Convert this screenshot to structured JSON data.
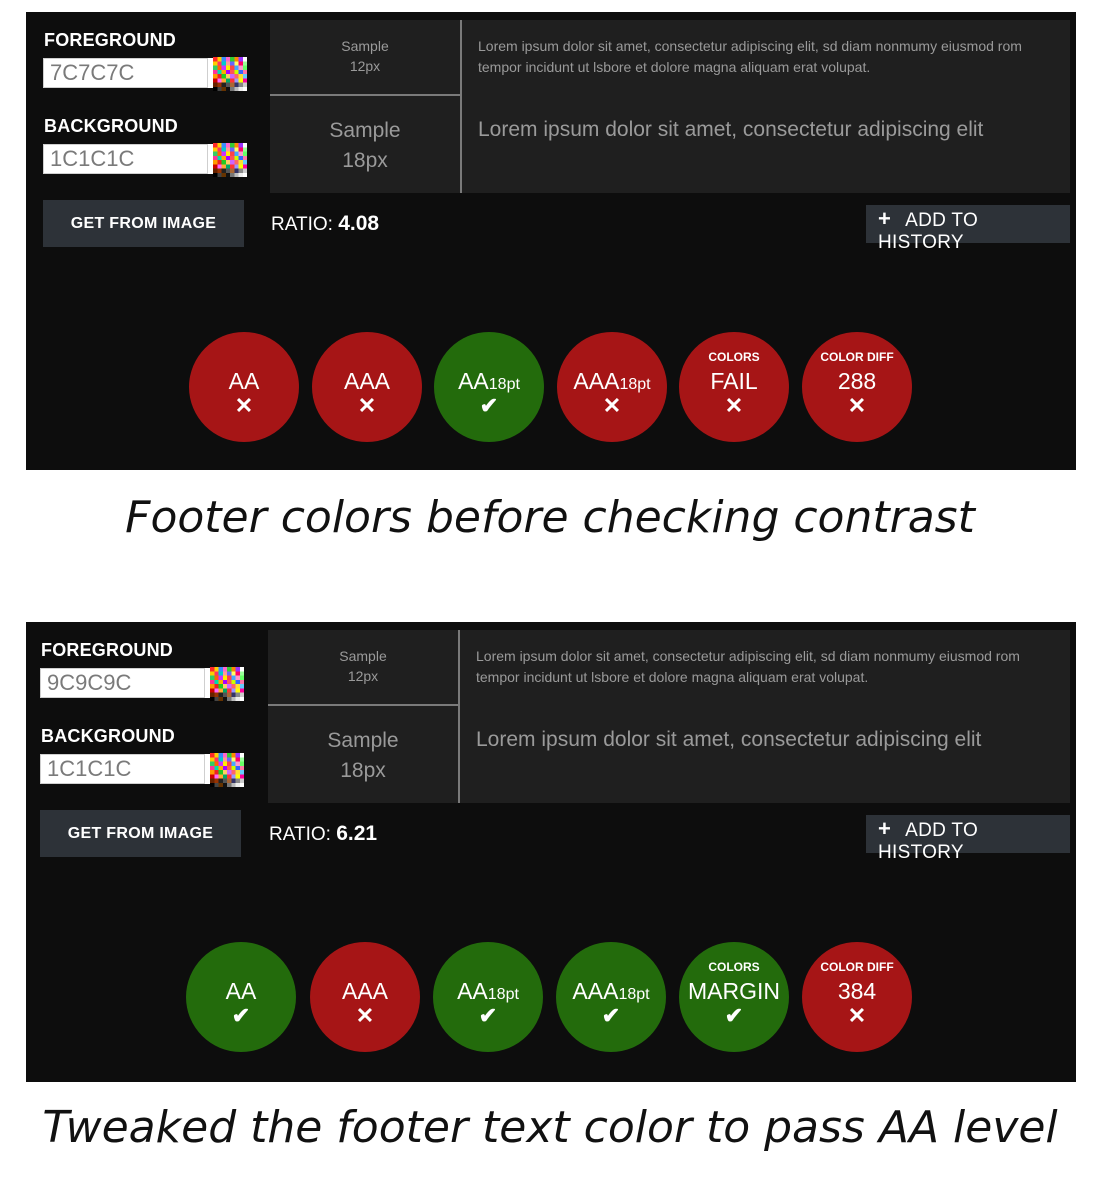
{
  "panels": [
    {
      "foreground_label": "FOREGROUND",
      "foreground_value": "7C7C7C",
      "background_label": "BACKGROUND",
      "background_value": "1C1C1C",
      "get_from_image": "GET FROM IMAGE",
      "sample_small": "Sample",
      "sample_small_size": "12px",
      "sample_large": "Sample",
      "sample_large_size": "18px",
      "lorem_small": "Lorem ipsum dolor sit amet, consectetur adipiscing elit, sd diam nonmumy eiusmod rom tempor incidunt ut lsbore et dolore magna aliquam erat volupat.",
      "lorem_large": "Lorem ipsum dolor sit amet, consectetur adipiscing elit",
      "ratio_label": "RATIO:",
      "ratio_value": "4.08",
      "add_history": "ADD TO HISTORY",
      "badges": [
        {
          "main": "AA",
          "sub": "",
          "suffix": "",
          "mark": "✕",
          "color": "#a61516"
        },
        {
          "main": "AAA",
          "sub": "",
          "suffix": "",
          "mark": "✕",
          "color": "#a61516"
        },
        {
          "main": "AA",
          "sub": "",
          "suffix": "18pt",
          "mark": "✔",
          "color": "#236b0c"
        },
        {
          "main": "AAA",
          "sub": "",
          "suffix": "18pt",
          "mark": "✕",
          "color": "#a61516"
        },
        {
          "main": "FAIL",
          "sub": "COLORS",
          "suffix": "",
          "mark": "✕",
          "color": "#a61516"
        },
        {
          "main": "288",
          "sub": "COLOR DIFF",
          "suffix": "",
          "mark": "✕",
          "color": "#a61516"
        }
      ],
      "caption": "Footer colors before checking contrast"
    },
    {
      "foreground_label": "FOREGROUND",
      "foreground_value": "9C9C9C",
      "background_label": "BACKGROUND",
      "background_value": "1C1C1C",
      "get_from_image": "GET FROM IMAGE",
      "sample_small": "Sample",
      "sample_small_size": "12px",
      "sample_large": "Sample",
      "sample_large_size": "18px",
      "lorem_small": "Lorem ipsum dolor sit amet, consectetur adipiscing elit, sd diam nonmumy eiusmod rom tempor incidunt ut lsbore et dolore magna aliquam erat volupat.",
      "lorem_large": "Lorem ipsum dolor sit amet, consectetur adipiscing elit",
      "ratio_label": "RATIO:",
      "ratio_value": "6.21",
      "add_history": "ADD TO HISTORY",
      "badges": [
        {
          "main": "AA",
          "sub": "",
          "suffix": "",
          "mark": "✔",
          "color": "#236b0c"
        },
        {
          "main": "AAA",
          "sub": "",
          "suffix": "",
          "mark": "✕",
          "color": "#a61516"
        },
        {
          "main": "AA",
          "sub": "",
          "suffix": "18pt",
          "mark": "✔",
          "color": "#236b0c"
        },
        {
          "main": "AAA",
          "sub": "",
          "suffix": "18pt",
          "mark": "✔",
          "color": "#236b0c"
        },
        {
          "main": "MARGIN",
          "sub": "COLORS",
          "suffix": "",
          "mark": "✔",
          "color": "#236b0c"
        },
        {
          "main": "384",
          "sub": "COLOR DIFF",
          "suffix": "",
          "mark": "✕",
          "color": "#a61516"
        }
      ],
      "caption": "Tweaked the footer text color to pass AA level"
    }
  ]
}
